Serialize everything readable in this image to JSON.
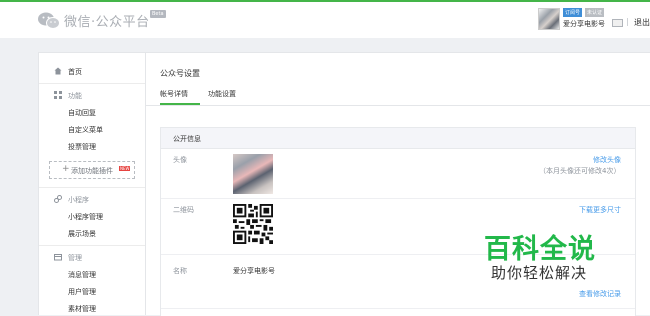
{
  "header": {
    "logo_icon": "wechat-icon",
    "logo_text": "微信·公众平台",
    "beta_badge": "Beta",
    "account_badge_1": "订阅号",
    "account_badge_2": "未认证",
    "account_name": "爱分享电影号",
    "mail_icon": "mail-icon",
    "logout": "退出"
  },
  "sidebar": {
    "home": "首页",
    "feature_group": "功能",
    "feature_items": [
      "自动回复",
      "自定义菜单",
      "投票管理"
    ],
    "add_plugin": "添加功能插件",
    "add_plugin_new": "NEW",
    "miniapp_group": "小程序",
    "miniapp_items": [
      "小程序管理",
      "展示场景"
    ],
    "manage_group": "管理",
    "manage_items": [
      "消息管理",
      "用户管理",
      "素材管理"
    ]
  },
  "main": {
    "page_title": "公众号设置",
    "tabs": [
      "帐号详情",
      "功能设置"
    ],
    "active_tab": 0,
    "panel_title": "公开信息",
    "rows": {
      "avatar_label": "头像",
      "avatar_action": "修改头像",
      "avatar_note": "（本月头像还可修改4次）",
      "qrcode_label": "二维码",
      "qrcode_action": "下载更多尺寸",
      "name_label": "名称",
      "name_value": "爱分享电影号",
      "name_action": "查看修改记录"
    }
  },
  "watermark": {
    "title": "百科全说",
    "subtitle": "助你轻松解决"
  },
  "colors": {
    "accent_green": "#44b549",
    "link_blue": "#459ae9",
    "watermark_green": "#22b84a"
  }
}
